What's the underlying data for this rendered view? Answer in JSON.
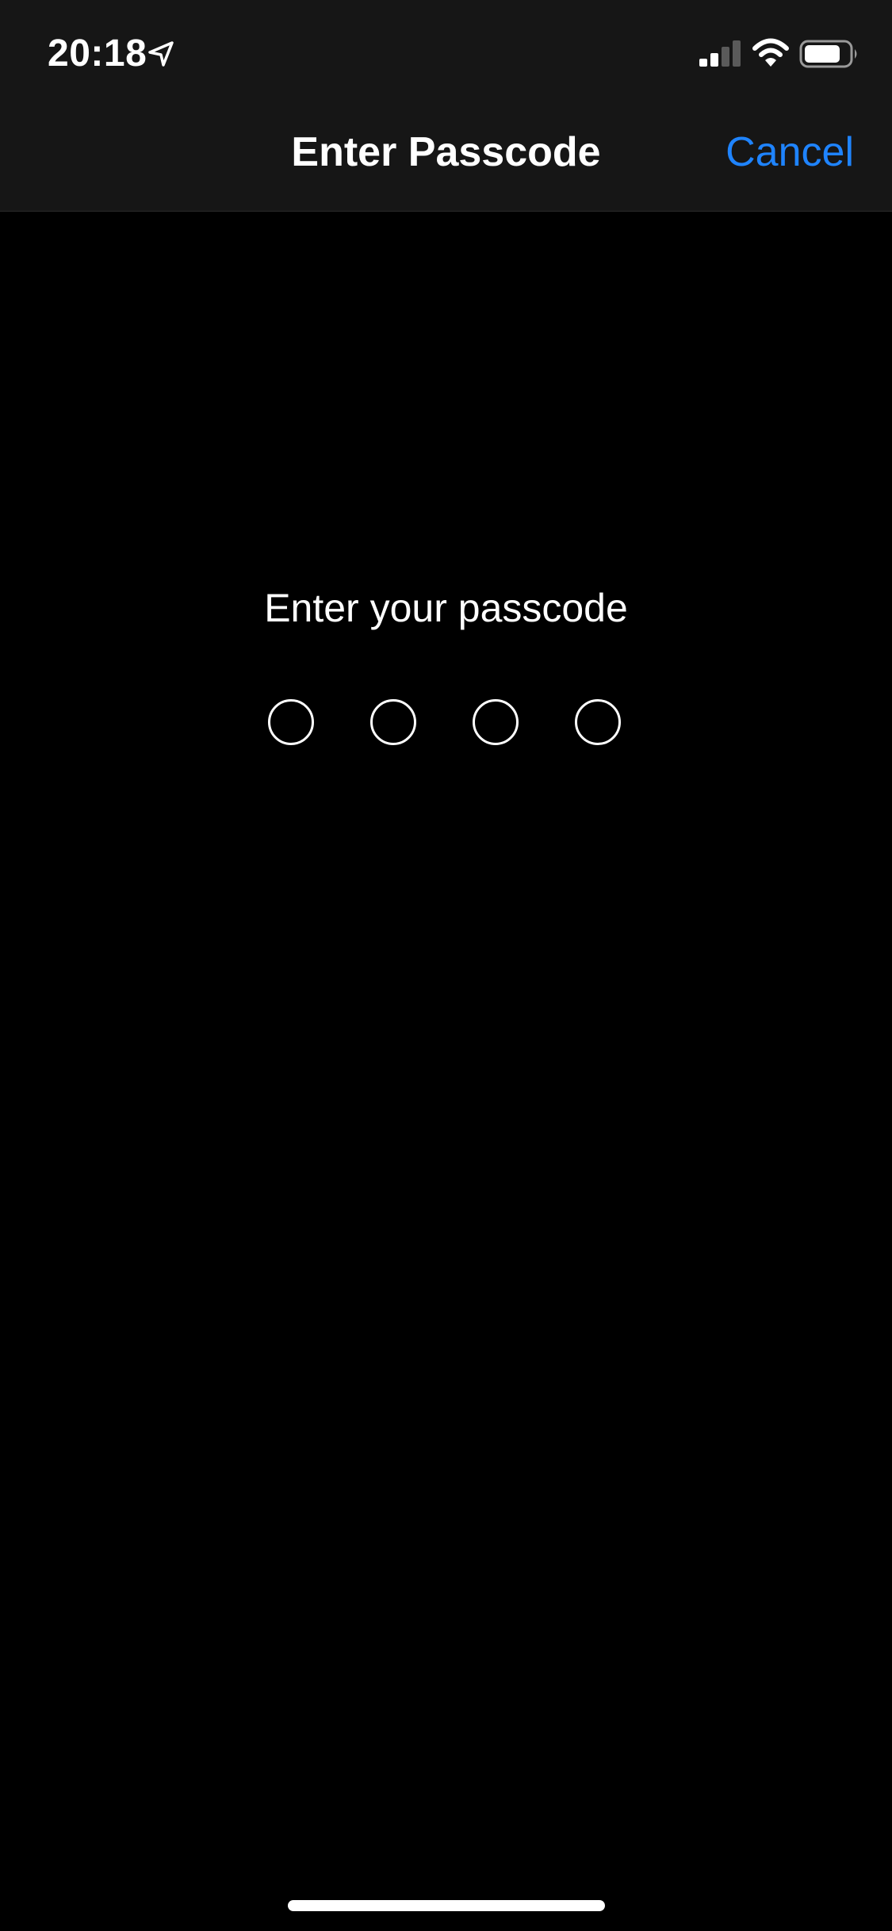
{
  "status_bar": {
    "time": "20:18",
    "icons": [
      "location-arrow-icon",
      "cellular-signal-icon",
      "wifi-icon",
      "battery-icon"
    ]
  },
  "nav": {
    "title": "Enter Passcode",
    "cancel_label": "Cancel"
  },
  "passcode": {
    "prompt": "Enter your passcode",
    "digit_count": 4,
    "entered_count": 0
  },
  "colors": {
    "accent": "#1f84ff",
    "background": "#000000",
    "top_bar": "#161616",
    "text": "#ffffff"
  }
}
